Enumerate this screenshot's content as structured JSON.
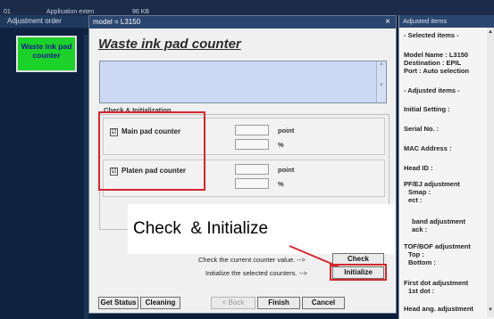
{
  "topbar": {
    "left_num": "01",
    "app": "Application exten",
    "size": "96 KB"
  },
  "left": {
    "header": "Adjustment order",
    "selected": "Waste ink pad counter"
  },
  "dialog": {
    "title": "model = L3150",
    "close": "×",
    "heading": "Waste ink pad counter",
    "group_title": "Check & Initialization",
    "main": {
      "label": "Main pad counter",
      "checked": "☑",
      "unit1": "point",
      "unit2": "%"
    },
    "platen": {
      "label": "Platen pad counter",
      "checked": "☑",
      "unit1": "point",
      "unit2": "%"
    },
    "check_text": "Check the current counter value.  -->",
    "init_text": "Initialize the selected counters.  -->",
    "check_btn": "Check",
    "init_btn": "Initialize",
    "overlay": "Check  & Initialize",
    "bottom": {
      "status": "Get Status",
      "cleaning": "Cleaning",
      "back": "< Back",
      "finish": "Finish",
      "cancel": "Cancel"
    }
  },
  "right": {
    "header": "Adjusted items",
    "items": [
      "- Selected items -",
      "Model Name : L3150",
      "Destination : EPIL",
      "Port : Auto selection",
      "- Adjusted items -",
      "Initial Setting :",
      "Serial No. :",
      "MAC Address :",
      "Head ID :",
      "PF/EJ adjustment",
      "Smap :",
      "ect :",
      "band adjustment",
      "ack :",
      "TOF/BOF adjustment",
      "Top :",
      "Bottom :",
      "First dot adjustment",
      "1st dot :",
      "Head ang. adjustment"
    ]
  },
  "colors": {
    "accent_red": "#d4262d",
    "selected_green": "#1cd12a",
    "titlebar": "#2b4670"
  }
}
